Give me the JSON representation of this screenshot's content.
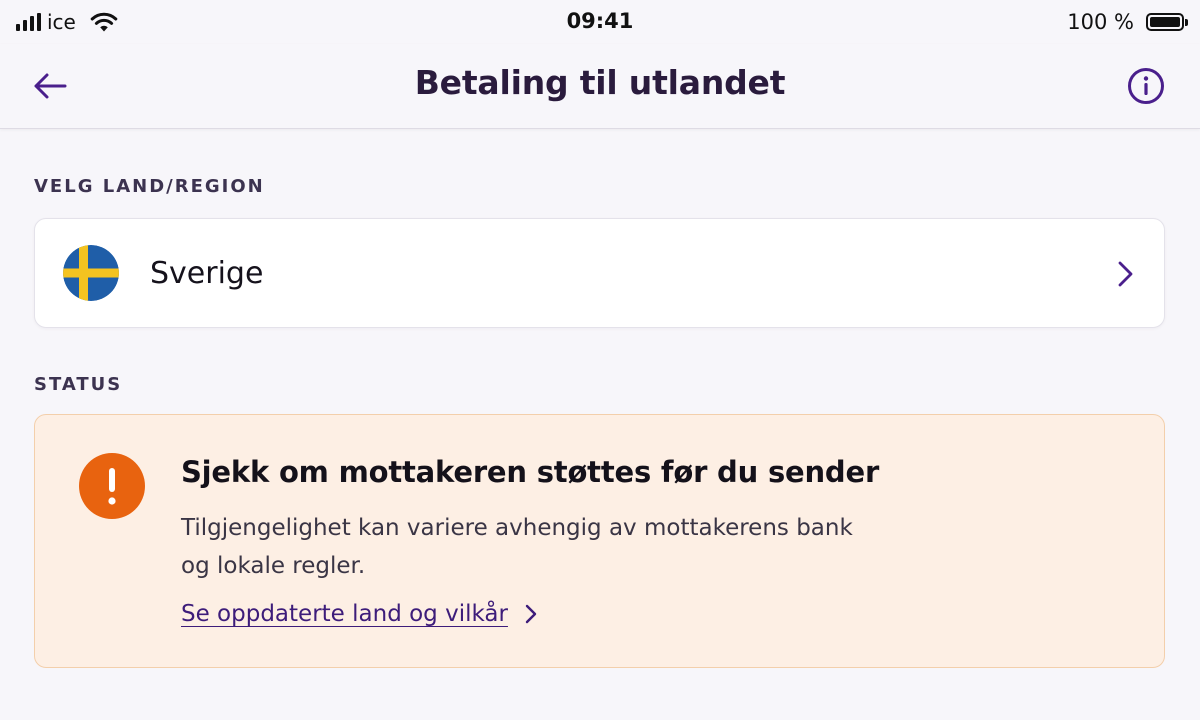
{
  "status_bar": {
    "carrier": "ice",
    "time": "09:41",
    "battery_text": "100 %",
    "battery_level": 1.0
  },
  "header": {
    "title": "Betaling til utlandet",
    "back_icon": "arrow-left-icon",
    "info_icon": "info-circle-icon"
  },
  "country_section": {
    "label": "VELG LAND/REGION",
    "selected_country": "Sverige",
    "flag_icon": "sweden-flag-icon",
    "chevron_icon": "chevron-right-icon"
  },
  "status_section": {
    "label": "STATUS",
    "heading": "Sjekk om mottakeren støttes før du sender",
    "body_line1": "Tilgjengelighet kan variere avhengig av mottakerens bank",
    "body_line2": "og lokale regler.",
    "link_text": "Se oppdaterte land og vilkår",
    "warning_icon": "exclamation-circle-icon"
  },
  "colors": {
    "accent": "#4a1f8c",
    "warning": "#e8630f",
    "status_card_bg": "#fdefe4",
    "flag_blue": "#1f5ea8",
    "flag_yellow": "#f4c320"
  }
}
